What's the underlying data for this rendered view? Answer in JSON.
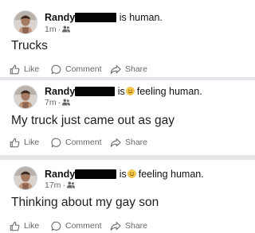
{
  "posts": [
    {
      "author": "Randy",
      "status": "is human.",
      "feeling_emoji": "",
      "time": "1m",
      "audience_icon": "friends-icon",
      "text": "Trucks",
      "actions": {
        "like": "Like",
        "comment": "Comment",
        "share": "Share"
      }
    },
    {
      "author": "Randy",
      "status_prefix": "is",
      "feeling_emoji": "slightly-smiling-emoji",
      "status": "feeling human.",
      "time": "7m",
      "audience_icon": "friends-icon",
      "text": "My truck just came out as gay",
      "actions": {
        "like": "Like",
        "comment": "Comment",
        "share": "Share"
      }
    },
    {
      "author": "Randy",
      "status_prefix": "is",
      "feeling_emoji": "slightly-smiling-emoji",
      "status": "feeling human.",
      "time": "17m",
      "audience_icon": "friends-icon",
      "text": "Thinking about my gay son",
      "actions": {
        "like": "Like",
        "comment": "Comment",
        "share": "Share"
      }
    }
  ],
  "colors": {
    "background": "#e4e6ea",
    "card": "#ffffff",
    "secondary_text": "#65676b",
    "redaction": "#050505",
    "emoji": "#f7c948"
  },
  "meta_separator": "·"
}
